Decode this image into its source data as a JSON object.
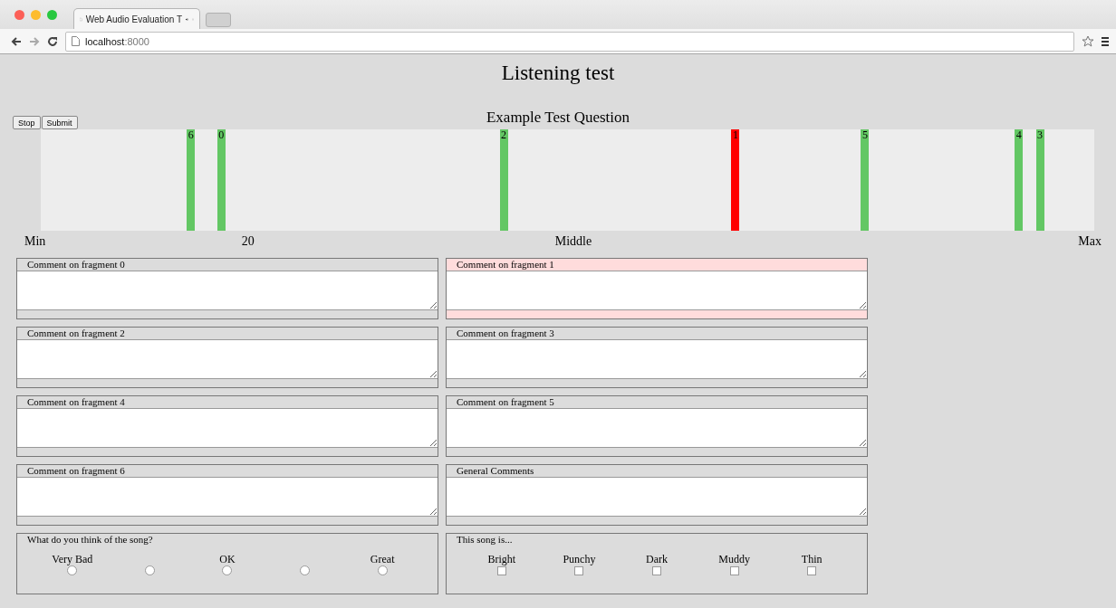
{
  "browser": {
    "tab_title": "Web Audio Evaluation T",
    "address": {
      "host": "localhost",
      "port": ":8000"
    }
  },
  "page": {
    "title": "Listening test",
    "question": "Example Test Question",
    "buttons": [
      "Stop",
      "Submit"
    ],
    "markers": [
      {
        "label": "6",
        "level": 0.142,
        "selected": false
      },
      {
        "label": "0",
        "level": 0.171,
        "selected": false
      },
      {
        "label": "2",
        "level": 0.439,
        "selected": false
      },
      {
        "label": "1",
        "level": 0.659,
        "selected": true
      },
      {
        "label": "5",
        "level": 0.782,
        "selected": false
      },
      {
        "label": "4",
        "level": 0.928,
        "selected": false
      },
      {
        "label": "3",
        "level": 0.948,
        "selected": false
      }
    ],
    "scale_labels": [
      "Min",
      "20",
      "Middle",
      "Max"
    ],
    "comments": [
      {
        "title": "Comment on fragment 0",
        "selected": false
      },
      {
        "title": "Comment on fragment 1",
        "selected": true
      },
      {
        "title": "Comment on fragment 2",
        "selected": false
      },
      {
        "title": "Comment on fragment 3",
        "selected": false
      },
      {
        "title": "Comment on fragment 4",
        "selected": false
      },
      {
        "title": "Comment on fragment 5",
        "selected": false
      },
      {
        "title": "Comment on fragment 6",
        "selected": false
      },
      {
        "title": "General Comments",
        "selected": false
      }
    ],
    "radio_question": {
      "title": "What do you think of the song?",
      "options": [
        {
          "label": "Very Bad",
          "selected": false
        },
        {
          "selected": false
        },
        {
          "label": "OK",
          "selected": false
        },
        {
          "selected": false
        },
        {
          "label": "Great",
          "selected": false
        }
      ]
    },
    "checkbox_question": {
      "title": "This song is...",
      "options": [
        {
          "label": "Bright",
          "checked": false
        },
        {
          "label": "Punchy",
          "checked": false
        },
        {
          "label": "Dark",
          "checked": false
        },
        {
          "label": "Muddy",
          "checked": false
        },
        {
          "label": "Thin",
          "checked": false
        }
      ]
    }
  }
}
